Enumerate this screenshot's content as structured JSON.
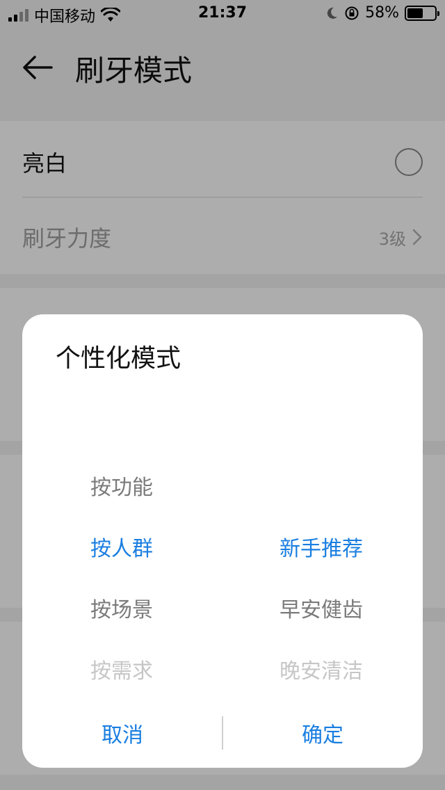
{
  "status_bar": {
    "carrier": "中国移动",
    "time": "21:37",
    "battery_text": "58%",
    "battery_level": 0.58,
    "icons": [
      "signal-icon",
      "wifi-icon",
      "moon-icon",
      "rotation-lock-icon",
      "battery-icon"
    ]
  },
  "header": {
    "title": "刷牙模式",
    "back_icon": "arrow-left-icon"
  },
  "settings": {
    "items": [
      {
        "label": "亮白",
        "control": "radio"
      },
      {
        "label": "刷牙力度",
        "value": "3级",
        "control": "chevron-right"
      }
    ]
  },
  "dialog": {
    "title": "个性化模式",
    "left_column": [
      "按功能",
      "按人群",
      "按场景",
      "按需求"
    ],
    "left_selected": "按人群",
    "right_column": [
      "新手推荐",
      "早安健齿",
      "晚安清洁"
    ],
    "right_selected": "新手推荐",
    "cancel_label": "取消",
    "confirm_label": "确定"
  },
  "colors": {
    "accent": "#1a7ee0",
    "overlay": "rgba(0,0,0,0.32)"
  }
}
